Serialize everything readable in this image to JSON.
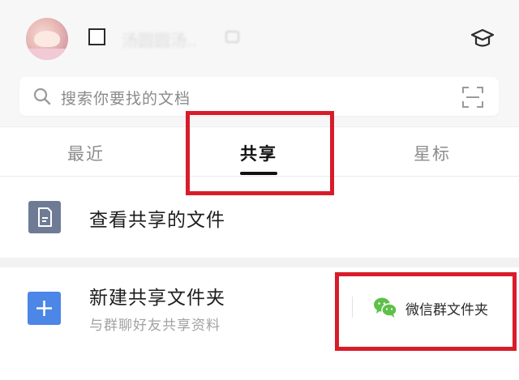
{
  "colors": {
    "highlight": "#d81c2a",
    "plus_tile": "#4c86e6",
    "file_tile": "#6f7b95",
    "wechat_green": "#5ec04a"
  },
  "header": {
    "username": "汤圆圆汤..",
    "avatar_icon": "avatar",
    "checkbox_icon": "square-checkbox",
    "right_icon": "graduation-cap-icon"
  },
  "search": {
    "placeholder": "搜索你要找的文档",
    "left_icon": "search-icon",
    "right_icon": "scan-icon"
  },
  "tabs": [
    {
      "label": "最近",
      "active": false
    },
    {
      "label": "共享",
      "active": true
    },
    {
      "label": "星标",
      "active": false
    }
  ],
  "shared_files": {
    "label": "查看共享的文件",
    "icon": "document-icon"
  },
  "new_shared_folder": {
    "title": "新建共享文件夹",
    "subtitle": "与群聊好友共享资料",
    "icon": "plus-icon",
    "wechat_button": {
      "label": "微信群文件夹",
      "icon": "wechat-icon"
    }
  }
}
